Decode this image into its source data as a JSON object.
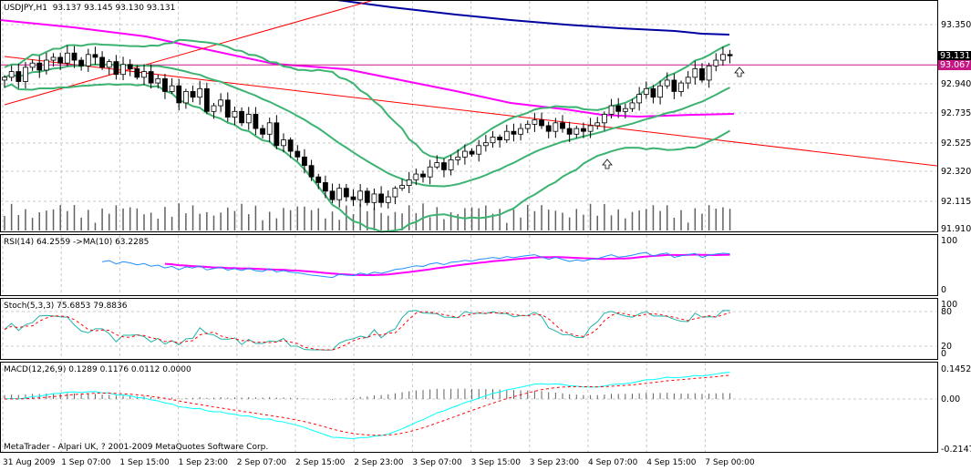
{
  "header": {
    "symbol": "USDJPY,H1",
    "open": "93.137",
    "high": "93.145",
    "low": "93.130",
    "close": "93.131"
  },
  "price_axis": {
    "ticks": [
      "93.350",
      "92.940",
      "92.735",
      "92.525",
      "92.320",
      "92.115",
      "91.910"
    ],
    "bid_tag": "93.131",
    "line_tag": "93.067"
  },
  "rsi": {
    "label": "RSI(14) 64.2559  ->MA(10) 63.2285",
    "ticks": [
      "100",
      "0"
    ]
  },
  "stoch": {
    "label": "Stoch(5,3,3) 75.6853 79.8836",
    "ticks": [
      "100",
      "80",
      "20",
      "0"
    ]
  },
  "macd": {
    "label": "MACD(12,26,9) 0.1289 0.1176 0.0112 0.0000",
    "ticks": [
      "0.1452",
      "0.00",
      "-0.2147"
    ]
  },
  "copyright": "MetaTrader - Alpari UK, ? 2001-2009 MetaQuotes Software Corp.",
  "time_axis": [
    "31 Aug 2009",
    "1 Sep 07:00",
    "1 Sep 15:00",
    "1 Sep 23:00",
    "2 Sep 07:00",
    "2 Sep 15:00",
    "2 Sep 23:00",
    "3 Sep 07:00",
    "3 Sep 15:00",
    "3 Sep 23:00",
    "4 Sep 07:00",
    "4 Sep 15:00",
    "7 Sep 00:00"
  ],
  "colors": {
    "bollinger": "#3CB371",
    "ma_blue": "#0000A0",
    "ma_magenta": "#FF00FF",
    "trendline": "#FF0000",
    "hline": "#C71585",
    "rsi": "#1E90FF",
    "stoch_main": "#20B2AA",
    "signal": "#FF0000",
    "macd_line": "#00FFFF"
  },
  "chart_data": {
    "type": "candlestick",
    "symbol": "USDJPY",
    "timeframe": "H1",
    "ylim": [
      91.91,
      93.35
    ],
    "hline": 93.067,
    "close": [
      92.98,
      93.02,
      92.95,
      93.05,
      93.08,
      93.03,
      93.1,
      93.12,
      93.08,
      93.15,
      93.1,
      93.06,
      93.14,
      93.12,
      93.05,
      93.09,
      93.0,
      93.07,
      93.04,
      92.98,
      93.02,
      92.94,
      92.97,
      92.88,
      92.92,
      92.8,
      92.88,
      92.84,
      92.9,
      92.74,
      92.78,
      92.82,
      92.7,
      92.74,
      92.66,
      92.72,
      92.62,
      92.58,
      92.66,
      92.5,
      92.54,
      92.46,
      92.42,
      92.36,
      92.28,
      92.24,
      92.18,
      92.12,
      92.2,
      92.14,
      92.12,
      92.18,
      92.1,
      92.16,
      92.1,
      92.14,
      92.2,
      92.22,
      92.26,
      92.3,
      92.28,
      92.35,
      92.38,
      92.33,
      92.4,
      92.42,
      92.46,
      92.44,
      92.5,
      92.52,
      92.56,
      92.54,
      92.6,
      92.58,
      92.62,
      92.65,
      92.68,
      92.64,
      92.6,
      92.66,
      92.62,
      92.58,
      92.62,
      92.6,
      92.64,
      92.66,
      92.72,
      92.78,
      92.74,
      92.76,
      92.8,
      92.86,
      92.9,
      92.84,
      92.92,
      92.96,
      92.88,
      92.94,
      92.98,
      93.04,
      92.96,
      93.06,
      93.1,
      93.14,
      93.131
    ]
  }
}
